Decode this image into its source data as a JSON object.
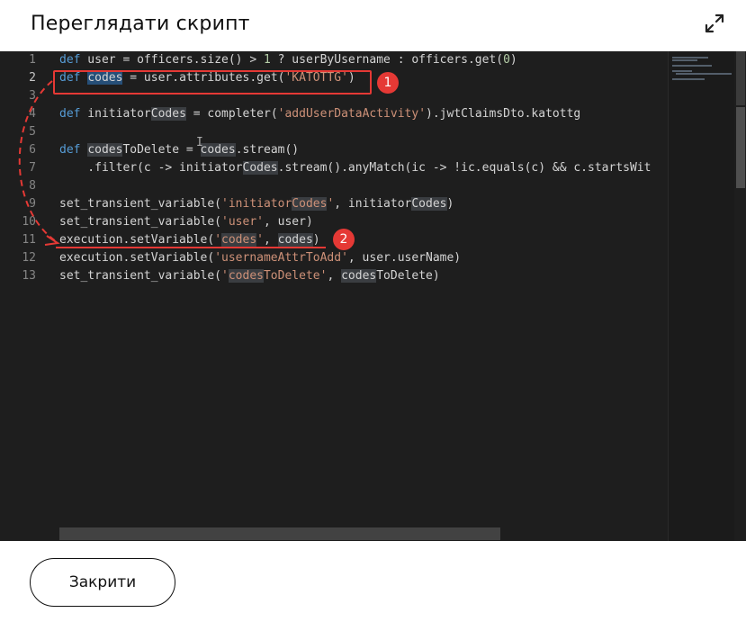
{
  "dialog": {
    "title": "Переглядати скрипт",
    "close_label": "Закрити"
  },
  "icons": {
    "expand": "expand-arrows-icon"
  },
  "colors": {
    "annotation": "#e53935",
    "editor_bg": "#1e1e1e",
    "keyword": "#569cd6",
    "string": "#ce9178"
  },
  "annotations": {
    "badge1": "1",
    "badge2": "2"
  },
  "editor": {
    "line_numbers": [
      "1",
      "2",
      "3",
      "4",
      "5",
      "6",
      "7",
      "8",
      "9",
      "10",
      "11",
      "12",
      "13"
    ],
    "lines": {
      "l1": {
        "kw": "def",
        "a": " user = officers.size() > ",
        "n": "1",
        "b": " ? userByUsername : officers.get(",
        "n2": "0",
        "c": ")"
      },
      "l2": {
        "kw": "def",
        "sp": " ",
        "v": "codes",
        "a": " = user.attributes.get(",
        "s": "'KATOTTG'",
        "c": ")"
      },
      "l4": {
        "kw": "def",
        "a": " initiator",
        "h": "Codes",
        "b": " = completer(",
        "s": "'addUserDataActivity'",
        "c": ").jwtClaimsDto.katottg"
      },
      "l6": {
        "kw": "def",
        "sp": " ",
        "h1": "codes",
        "a": "ToDelete = ",
        "h2": "codes",
        "c": ".stream()"
      },
      "l7": {
        "a": "    .filter(c -> initiator",
        "h": "Codes",
        "b": ".stream().anyMatch(ic -> !ic.equals(c) && c.startsWit"
      },
      "l9": {
        "a": "set_transient_variable(",
        "s1": "'initiator",
        "h1": "Codes",
        "s2": "'",
        "b": ", initiator",
        "h2": "Codes",
        "c": ")"
      },
      "l10": {
        "a": "set_transient_variable(",
        "s": "'user'",
        "c": ", user)"
      },
      "l11": {
        "a": "execution.setVariable(",
        "s1": "'",
        "h1": "codes",
        "s2": "'",
        "b": ", ",
        "h2": "codes",
        "c": ")"
      },
      "l12": {
        "a": "execution.setVariable(",
        "s": "'usernameAttrToAdd'",
        "c": ", user.userName)"
      },
      "l13": {
        "a": "set_transient_variable(",
        "s1": "'",
        "h1": "codes",
        "s2": "ToDelete'",
        "b": ", ",
        "h2": "codes",
        "c": "ToDelete)"
      }
    }
  }
}
